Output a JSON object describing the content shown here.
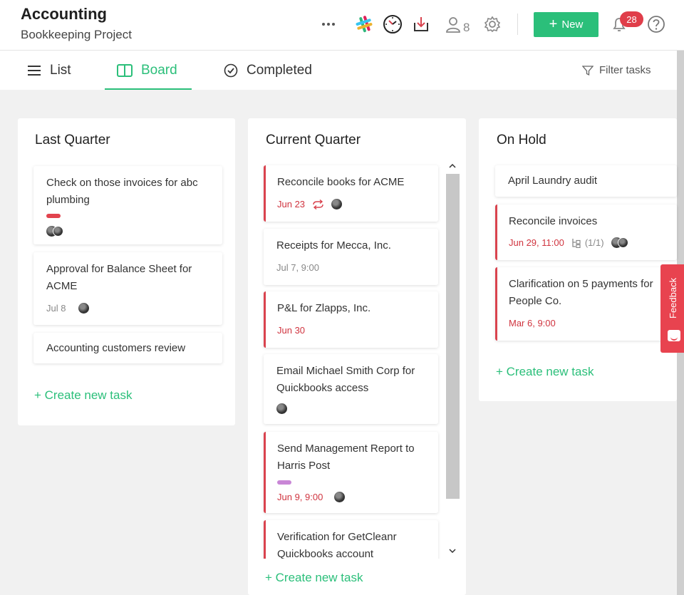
{
  "header": {
    "title": "Accounting",
    "subtitle": "Bookkeeping Project",
    "more_icon": "ellipsis-icon",
    "members_count": "8",
    "new_button_label": "New",
    "notification_count": "28",
    "accent_color": "#2bbf7a",
    "alert_color": "#e03e4a"
  },
  "tabs": [
    {
      "label": "List",
      "icon": "list-icon",
      "active": false
    },
    {
      "label": "Board",
      "icon": "board-icon",
      "active": true
    },
    {
      "label": "Completed",
      "icon": "check-circle-icon",
      "active": false
    }
  ],
  "filter_label": "Filter tasks",
  "columns": [
    {
      "title": "Last Quarter",
      "create_label": "+ Create new task",
      "cards": [
        {
          "title": "Check on those invoices  for abc plumbing",
          "label_color": "#e2434e",
          "avatars": 2
        },
        {
          "title": "Approval for Balance Sheet for ACME",
          "date": "Jul 8",
          "avatars": 1
        },
        {
          "title": "Accounting customers review"
        }
      ]
    },
    {
      "title": "Current Quarter",
      "create_label": "+ Create new task",
      "cards": [
        {
          "title": "Reconcile books for ACME",
          "date": "Jun 23",
          "overdue": true,
          "recurring": true,
          "avatars": 1
        },
        {
          "title": "Receipts for Mecca, Inc.",
          "date": "Jul 7, 9:00"
        },
        {
          "title": "P&L for Zlapps, Inc.",
          "date": "Jun 30",
          "overdue": true
        },
        {
          "title": "Email Michael Smith Corp for Quickbooks access",
          "avatars": 1
        },
        {
          "title": "Send Management Report to Harris Post",
          "label_color": "#c986d6",
          "date": "Jun 9, 9:00",
          "overdue": true,
          "avatars": 1
        },
        {
          "title": "Verification for GetCleanr Quickbooks account",
          "overdue": true
        }
      ]
    },
    {
      "title": "On Hold",
      "create_label": "+ Create new task",
      "cards": [
        {
          "title": "April Laundry audit"
        },
        {
          "title": "Reconcile invoices",
          "date": "Jun 29, 11:00",
          "overdue": true,
          "subtasks": "(1/1)",
          "avatars": 2
        },
        {
          "title": "Clarification on 5 payments for People Co.",
          "date": "Mar 6, 9:00",
          "overdue": true
        }
      ]
    }
  ],
  "feedback_label": "Feedback"
}
